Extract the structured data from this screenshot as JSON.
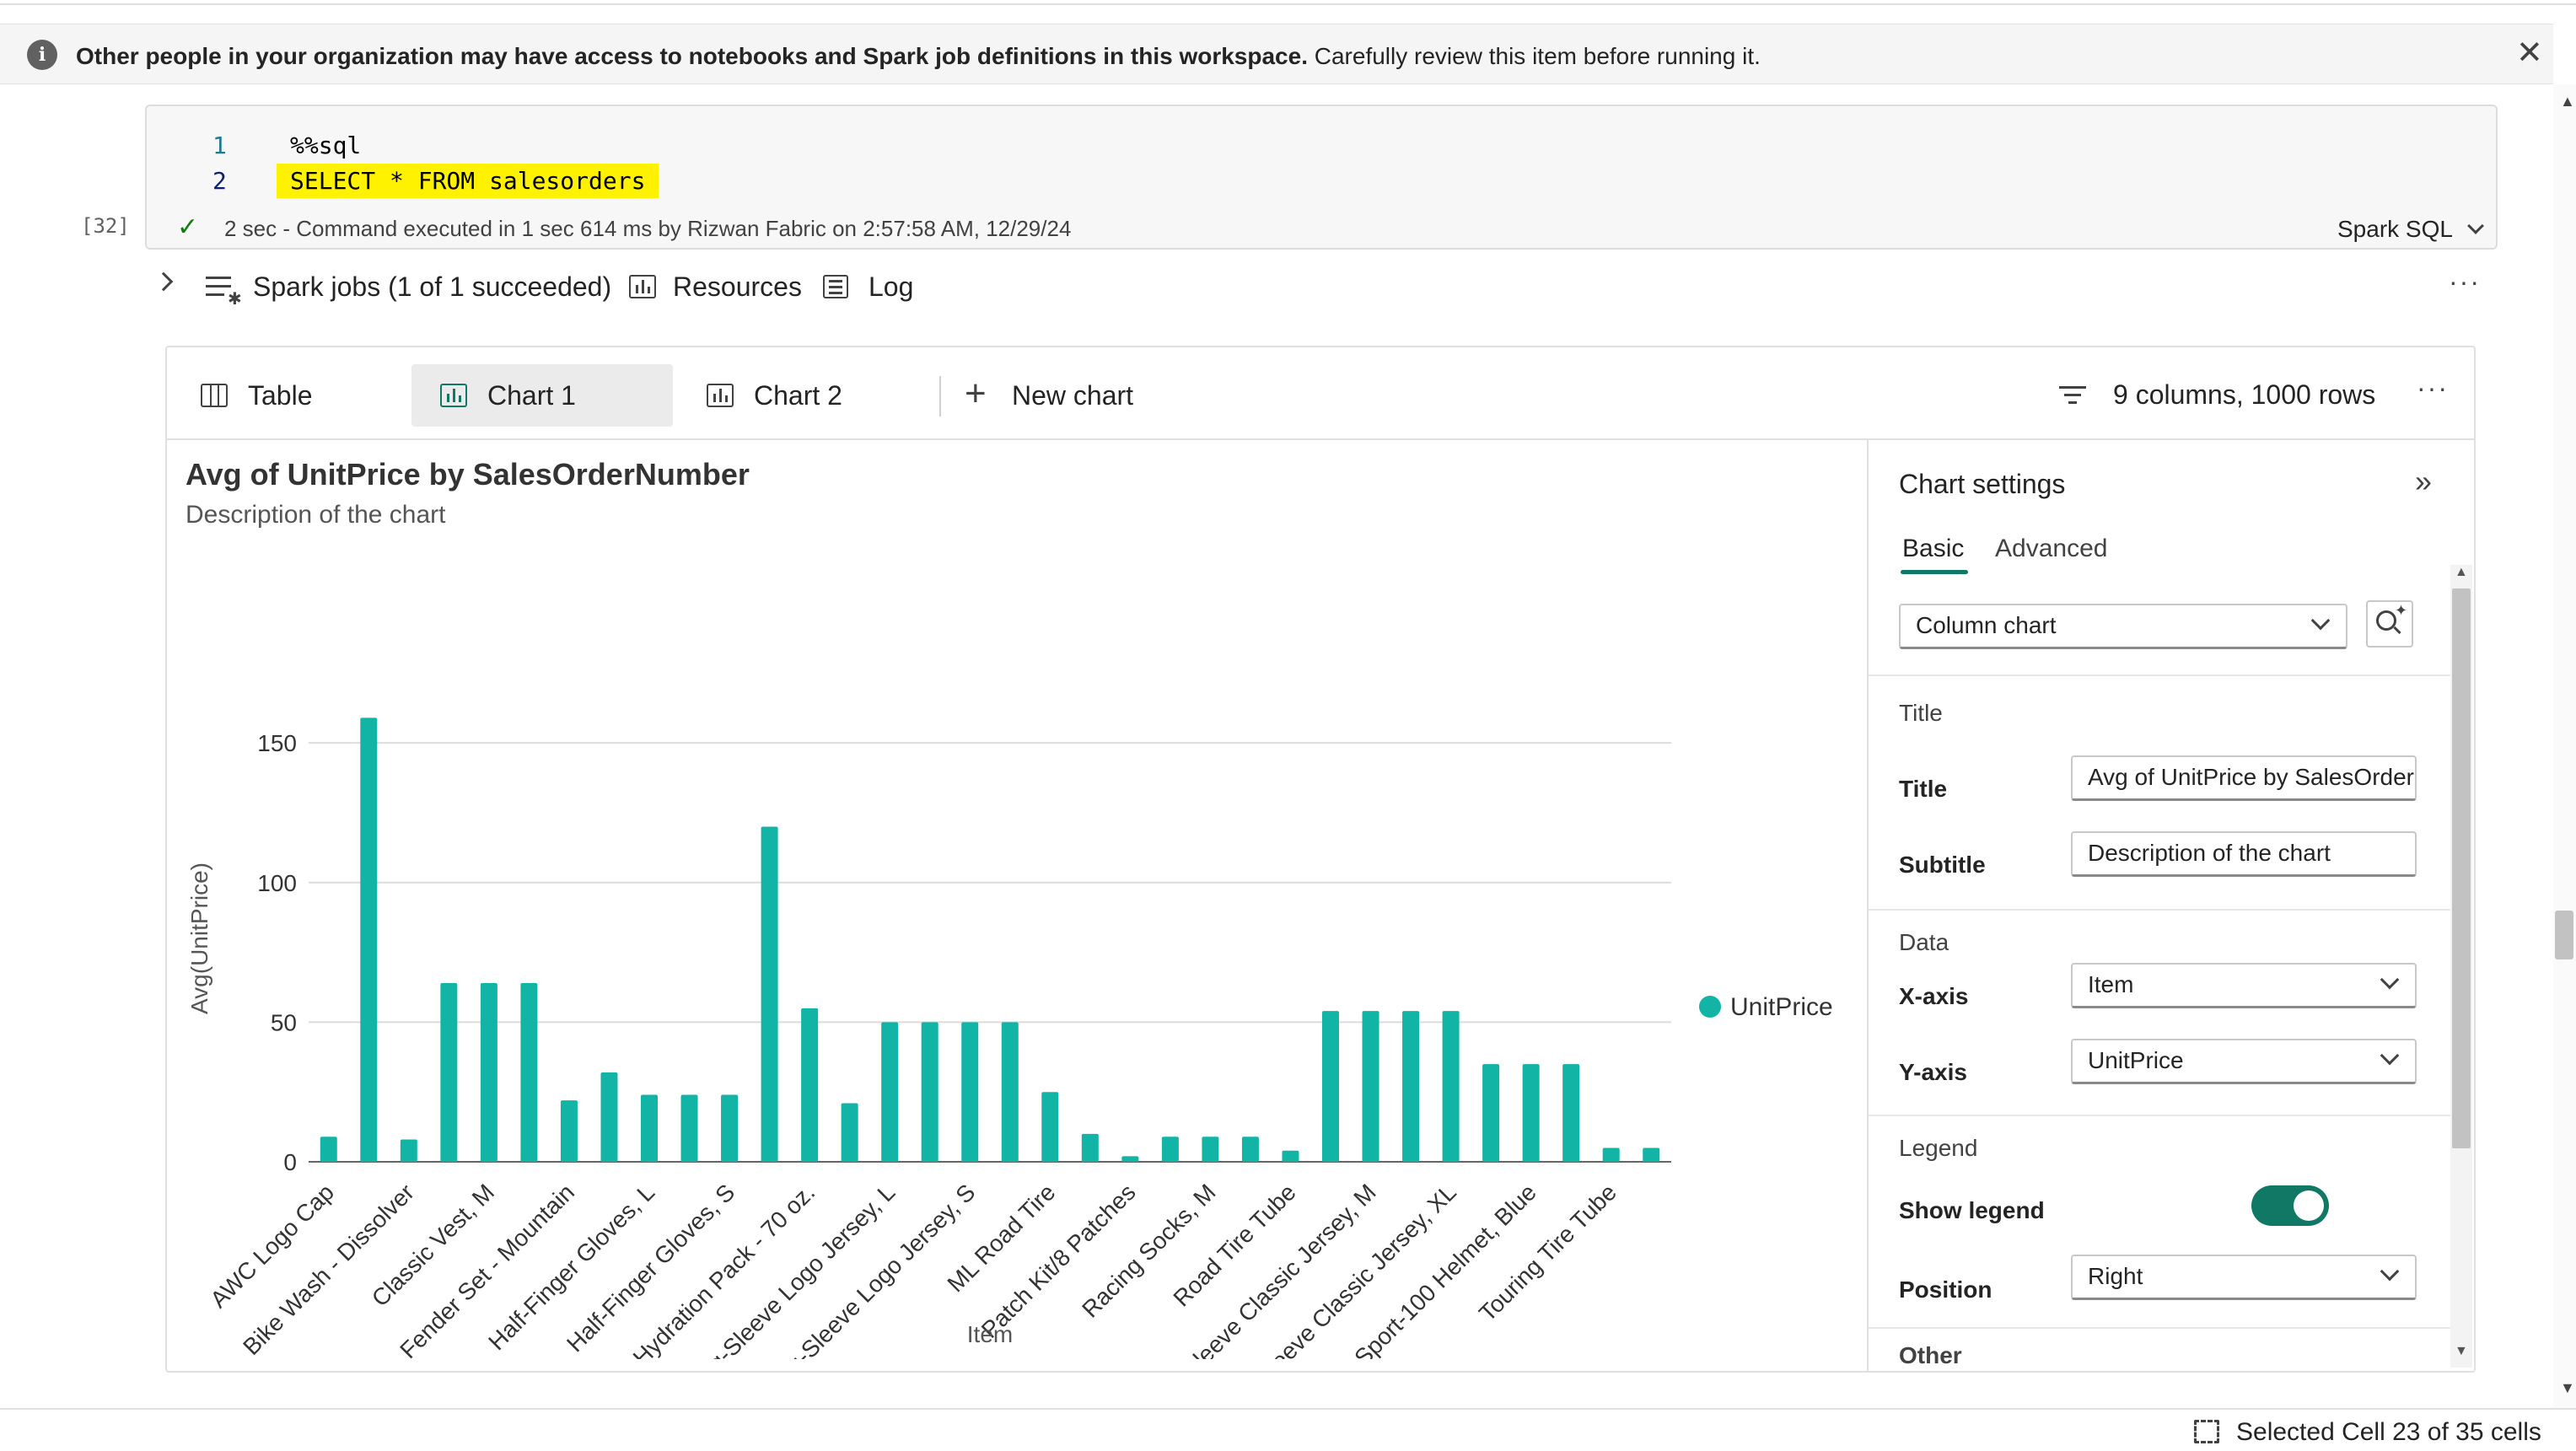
{
  "banner": {
    "bold_text": "Other people in your organization may have access to notebooks and Spark job definitions in this workspace.",
    "text": "Carefully review this item before running it.",
    "close_icon": "close-icon"
  },
  "cell": {
    "lines": [
      {
        "number": "1",
        "code": "%%sql"
      },
      {
        "number": "2",
        "code": "SELECT * FROM salesorders"
      }
    ],
    "exec_count": "[32]",
    "status": "2 sec - Command executed in 1 sec 614 ms by Rizwan Fabric on 2:57:58 AM, 12/29/24",
    "language": "Spark SQL"
  },
  "output_toolbar": {
    "spark_jobs": "Spark jobs (1 of 1 succeeded)",
    "resources": "Resources",
    "log": "Log",
    "more": "···"
  },
  "view_tabs": {
    "table": "Table",
    "chart1": "Chart 1",
    "chart2": "Chart 2",
    "new_chart": "New chart",
    "summary": "9 columns, 1000 rows",
    "more": "···"
  },
  "settings": {
    "header": "Chart settings",
    "tab_basic": "Basic",
    "tab_advanced": "Advanced",
    "chart_type": "Column chart",
    "group_title": "Title",
    "title_label": "Title",
    "title_value": "Avg of UnitPrice by SalesOrderl",
    "subtitle_label": "Subtitle",
    "subtitle_value": "Description of the chart",
    "group_data": "Data",
    "xaxis_label": "X-axis",
    "xaxis_value": "Item",
    "yaxis_label": "Y-axis",
    "yaxis_value": "UnitPrice",
    "group_legend": "Legend",
    "show_legend_label": "Show legend",
    "show_legend": true,
    "position_label": "Position",
    "position_value": "Right",
    "group_other": "Other"
  },
  "statusbar": {
    "text": "Selected Cell 23 of 35 cells"
  },
  "colors": {
    "bar": "#12b5a5",
    "highlight": "#fff200",
    "toggle": "#117865"
  },
  "chart_data": {
    "type": "bar",
    "title": "Avg of UnitPrice by SalesOrderNumber",
    "subtitle": "Description of the chart",
    "xlabel": "Item",
    "ylabel": "Avg(UnitPrice)",
    "ylim": [
      0,
      160
    ],
    "yticks": [
      0,
      50,
      100,
      150
    ],
    "grid": true,
    "legend": {
      "position": "right",
      "entries": [
        "UnitPrice"
      ]
    },
    "tick_labels": [
      "AWC Logo Cap",
      "Bike Wash - Dissolver",
      "Classic Vest, M",
      "Fender Set - Mountain",
      "Half-Finger Gloves, L",
      "Half-Finger Gloves, S",
      "Hydration Pack - 70 oz.",
      "Long-Sleeve Logo Jersey, L",
      "Long-Sleeve Logo Jersey, S",
      "ML Road Tire",
      "Patch Kit/8 Patches",
      "Racing Socks, M",
      "Road Tire Tube",
      "Short-Sleeve Classic Jersey, M",
      "Short-Sleeve Classic Jersey, XL",
      "Sport-100 Helmet, Blue",
      "Touring Tire Tube"
    ],
    "series": [
      {
        "name": "UnitPrice",
        "values": [
          9,
          159,
          8,
          64,
          64,
          64,
          22,
          32,
          24,
          24,
          24,
          120,
          55,
          21,
          50,
          50,
          50,
          50,
          25,
          10,
          2,
          9,
          9,
          9,
          4,
          54,
          54,
          54,
          54,
          35,
          35,
          35,
          5,
          5
        ]
      }
    ]
  }
}
